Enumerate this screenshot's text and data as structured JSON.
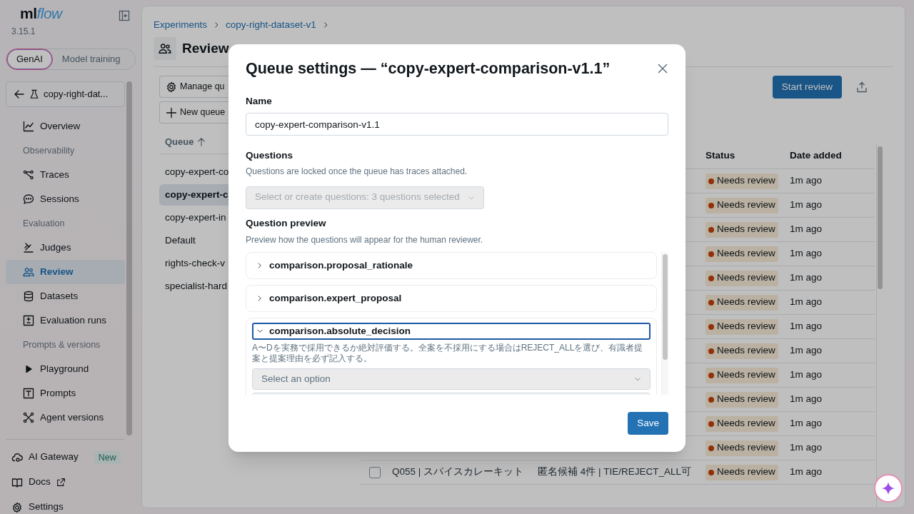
{
  "sidebar": {
    "logo": [
      "ml",
      "flow"
    ],
    "version": "3.15.1",
    "mode_tabs": [
      {
        "label": "GenAI",
        "selected": true
      },
      {
        "label": "Model training",
        "selected": false
      }
    ],
    "experiment": "copy-right-dat...",
    "nav": [
      {
        "kind": "item",
        "label": "Overview",
        "selected": false
      },
      {
        "kind": "section",
        "label": "Observability"
      },
      {
        "kind": "item",
        "label": "Traces",
        "selected": false
      },
      {
        "kind": "item",
        "label": "Sessions",
        "selected": false
      },
      {
        "kind": "section",
        "label": "Evaluation"
      },
      {
        "kind": "item",
        "label": "Judges",
        "selected": false
      },
      {
        "kind": "item",
        "label": "Review",
        "selected": true
      },
      {
        "kind": "item",
        "label": "Datasets",
        "selected": false
      },
      {
        "kind": "item",
        "label": "Evaluation runs",
        "selected": false
      },
      {
        "kind": "section",
        "label": "Prompts & versions"
      },
      {
        "kind": "item",
        "label": "Playground",
        "selected": false
      },
      {
        "kind": "item",
        "label": "Prompts",
        "selected": false
      },
      {
        "kind": "item",
        "label": "Agent versions",
        "selected": false
      }
    ],
    "footer": [
      {
        "label": "AI Gateway",
        "badge": "New",
        "external": false
      },
      {
        "label": "Docs",
        "external": true
      },
      {
        "label": "Settings",
        "external": false
      }
    ]
  },
  "main": {
    "breadcrumb": [
      "Experiments",
      "copy-right-dataset-v1"
    ],
    "title": "Review",
    "actions": [
      "Manage qu",
      "New queue"
    ],
    "queues": {
      "header": "Queue",
      "items": [
        {
          "label": "copy-expert-co",
          "selected": false
        },
        {
          "label": "copy-expert-c",
          "selected": true
        },
        {
          "label": "copy-expert-in",
          "selected": false
        },
        {
          "label": "Default",
          "selected": false
        },
        {
          "label": "rights-check-v",
          "selected": false
        },
        {
          "label": "specialist-hard",
          "selected": false
        }
      ]
    },
    "start_review": "Start review",
    "table": {
      "columns": [
        "Status",
        "Date added"
      ],
      "rows": [
        {
          "status": "Needs review",
          "added": "1m ago"
        },
        {
          "status": "Needs review",
          "added": "1m ago"
        },
        {
          "status": "Needs review",
          "added": "1m ago"
        },
        {
          "status": "Needs review",
          "added": "1m ago"
        },
        {
          "status": "Needs review",
          "added": "1m ago"
        },
        {
          "status": "Needs review",
          "added": "1m ago"
        },
        {
          "status": "Needs review",
          "added": "1m ago"
        },
        {
          "status": "Needs review",
          "added": "1m ago"
        },
        {
          "status": "Needs review",
          "added": "1m ago"
        },
        {
          "status": "Needs review",
          "added": "1m ago"
        },
        {
          "status": "Needs review",
          "added": "1m ago"
        },
        {
          "status": "Needs review",
          "added": "1m ago"
        },
        {
          "checked": false,
          "item": "Q055 | スパイスカレーキット",
          "summary": "匿名候補 4件 | TIE/REJECT_ALL可",
          "status": "Needs review",
          "added": "1m ago"
        }
      ]
    }
  },
  "modal": {
    "title": "Queue settings — “copy-expert-comparison-v1.1”",
    "name_label": "Name",
    "name_value": "copy-expert-comparison-v1.1",
    "questions_label": "Questions",
    "questions_hint": "Questions are locked once the queue has traces attached.",
    "questions_select": "Select or create questions: 3 questions selected",
    "questions_disabled": true,
    "preview_label": "Question preview",
    "preview_hint": "Preview how the questions will appear for the human reviewer.",
    "preview": [
      {
        "label": "comparison.proposal_rationale",
        "expanded": false,
        "focused": false
      },
      {
        "label": "comparison.expert_proposal",
        "expanded": false,
        "focused": false
      },
      {
        "label": "comparison.absolute_decision",
        "expanded": true,
        "focused": true,
        "description": "A〜Dを実務で採用できるか絶対評価する。全案を不採用にする場合はREJECT_ALLを選び、有識者提案と提案理由を必ず記入する。",
        "placeholder": "Select an option"
      }
    ],
    "save": "Save"
  }
}
